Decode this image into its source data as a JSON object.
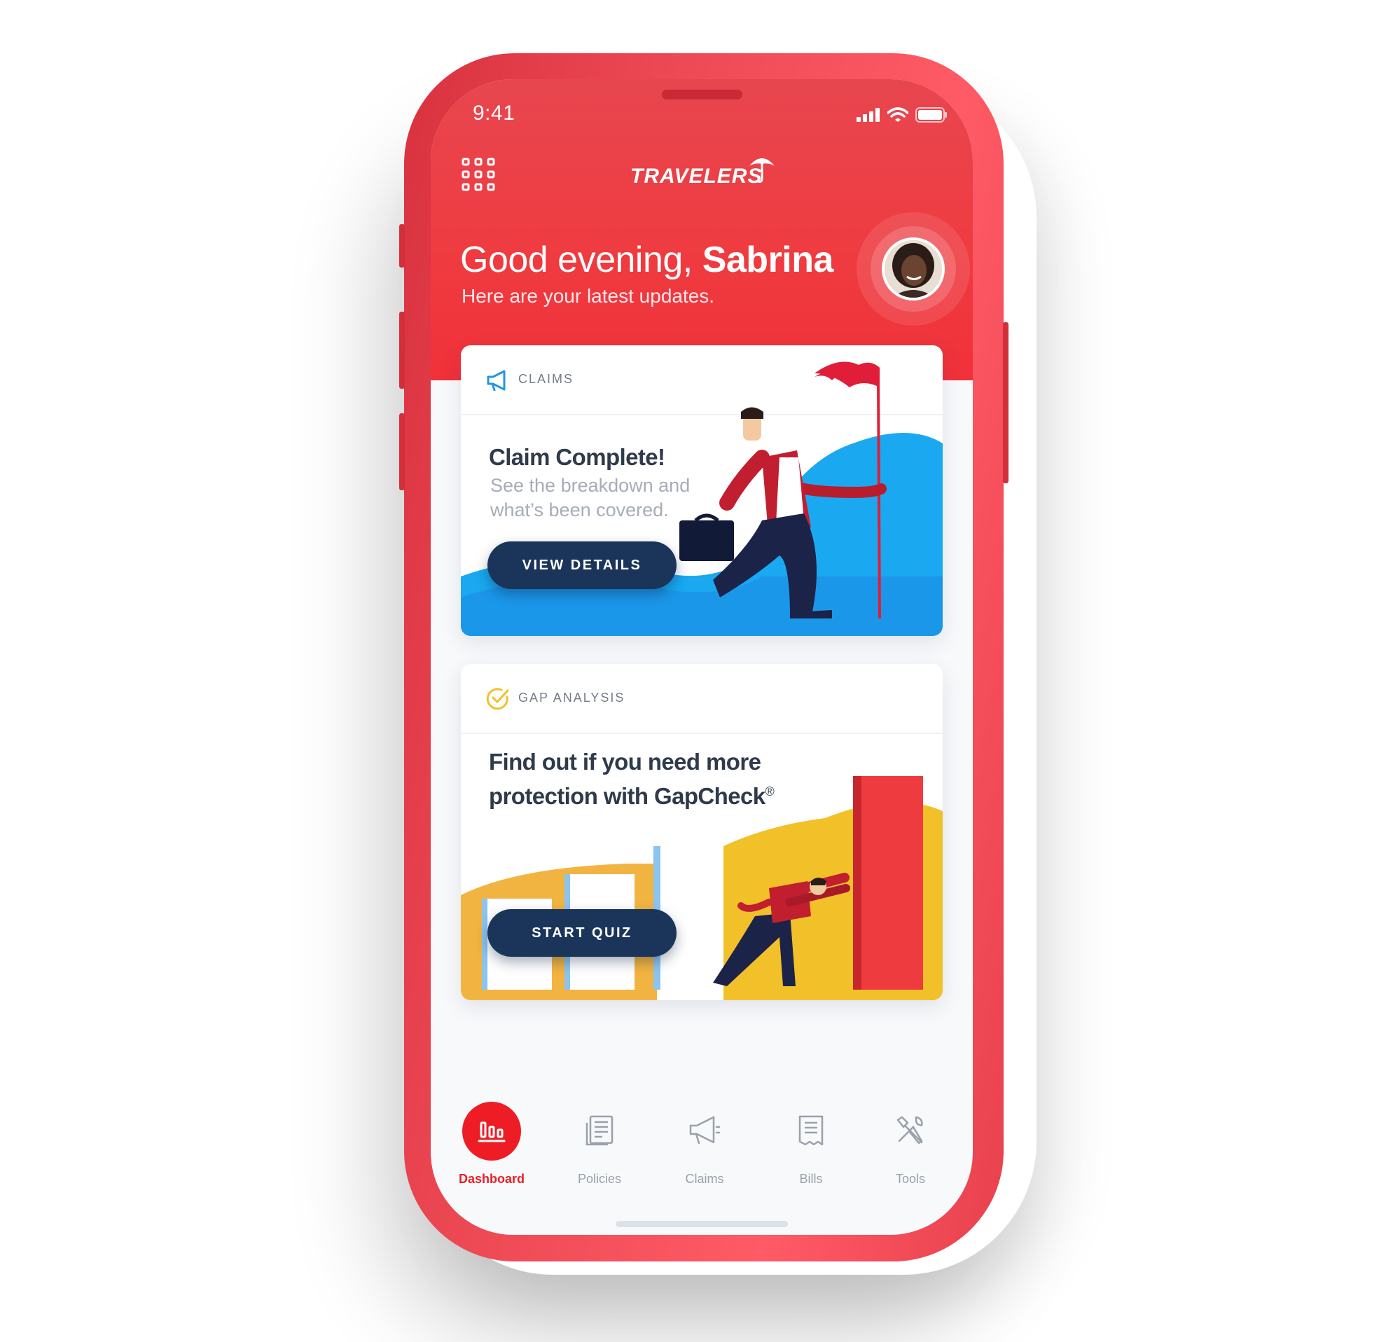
{
  "theme": {
    "brand_red": "#ee1c24",
    "navy": "#1b355a",
    "sky_blue": "#20a6f2",
    "yellow": "#f2c12a"
  },
  "status_bar": {
    "time": "9:41",
    "icons": [
      "signal-icon",
      "wifi-icon",
      "battery-icon"
    ]
  },
  "header": {
    "menu_icon": "grid-menu-icon",
    "logo": "TRAVELERS",
    "greeting_prefix": "Good evening, ",
    "greeting_name": "Sabrina",
    "subtitle": "Here are your latest updates."
  },
  "cards": [
    {
      "category": "CLAIMS",
      "icon": "megaphone-icon",
      "title": "Claim Complete!",
      "body_line1": "See the breakdown and",
      "body_line2": "what’s been covered.",
      "button": "VIEW DETAILS"
    },
    {
      "category": "GAP ANALYSIS",
      "icon": "check-circle-icon",
      "title_line1": "Find out if you need more",
      "title_line2": "protection with GapCheck",
      "title_mark": "®",
      "button": "START QUIZ"
    }
  ],
  "tabs": [
    {
      "label": "Dashboard",
      "icon": "dashboard-icon",
      "active": true
    },
    {
      "label": "Policies",
      "icon": "policies-icon",
      "active": false
    },
    {
      "label": "Claims",
      "icon": "megaphone-icon",
      "active": false
    },
    {
      "label": "Bills",
      "icon": "bills-icon",
      "active": false
    },
    {
      "label": "Tools",
      "icon": "tools-icon",
      "active": false
    }
  ]
}
